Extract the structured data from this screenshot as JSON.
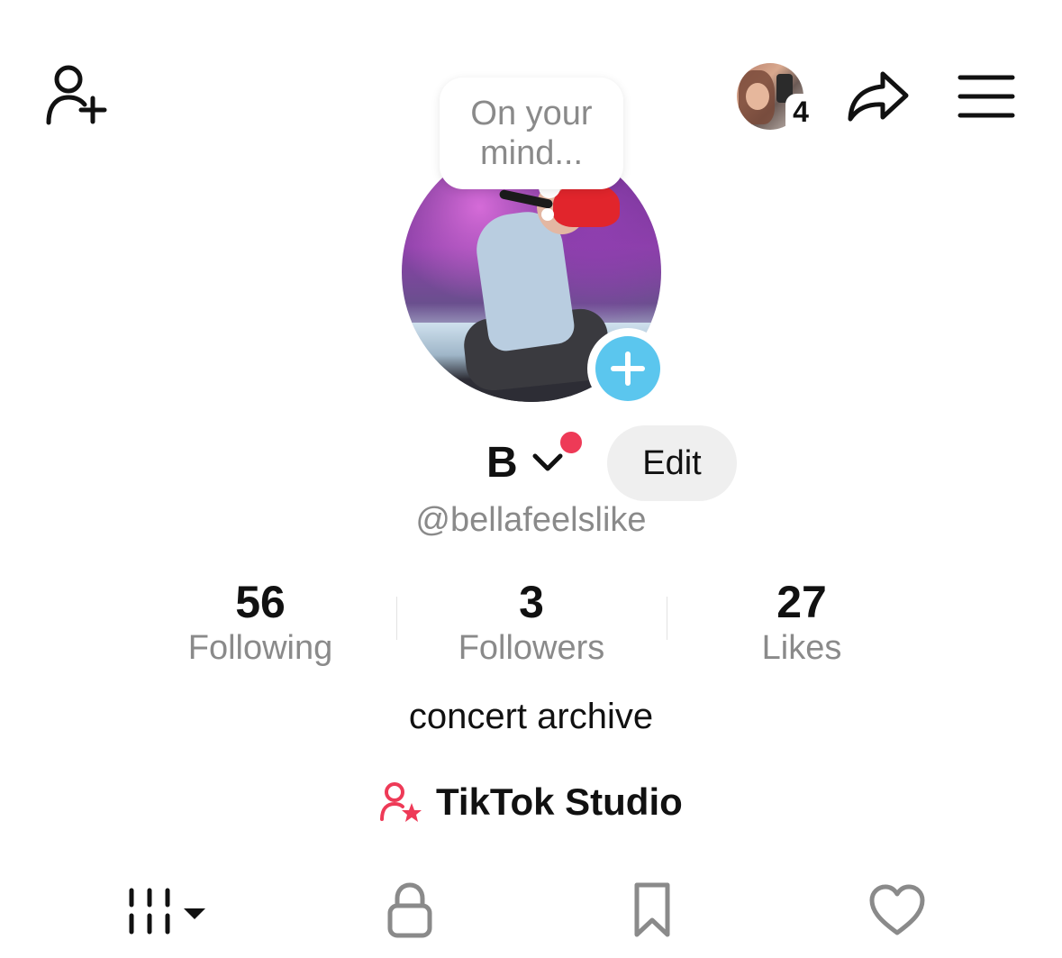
{
  "top_bar": {
    "add_friend_icon": "person-plus-icon",
    "story_count": "4",
    "share_icon": "share-arrow-icon",
    "menu_icon": "hamburger-menu-icon"
  },
  "profile": {
    "note_bubble": "On your mind...",
    "display_name": "B",
    "edit_label": "Edit",
    "username": "@bellafeelslike",
    "bio": "concert archive"
  },
  "stats": [
    {
      "value": "56",
      "label": "Following"
    },
    {
      "value": "3",
      "label": "Followers"
    },
    {
      "value": "27",
      "label": "Likes"
    }
  ],
  "studio": {
    "label": "TikTok Studio",
    "icon": "creator-star-icon",
    "accent_color": "#ee3a57"
  },
  "tabs": [
    {
      "name": "videos-grid-icon",
      "selected": true
    },
    {
      "name": "lock-icon",
      "selected": false
    },
    {
      "name": "bookmark-icon",
      "selected": false
    },
    {
      "name": "heart-icon",
      "selected": false
    }
  ],
  "colors": {
    "add_story_blue": "#5bc6ee",
    "notification_red": "#ee3a57",
    "secondary_text": "#8a8a8a"
  }
}
